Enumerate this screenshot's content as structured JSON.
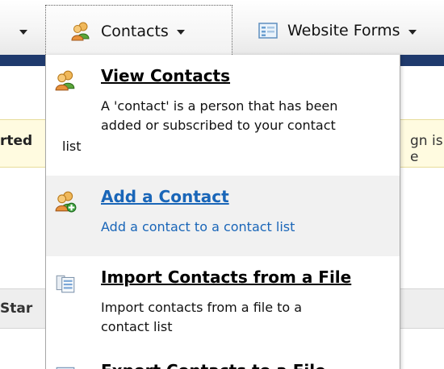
{
  "nav": {
    "contacts_label": "Contacts",
    "website_forms_label": "Website Forms"
  },
  "background": {
    "notice_left_text": "rted",
    "notice_right_text": "gn is e",
    "strip_left_text": "Star"
  },
  "menu": {
    "items": [
      {
        "title": "View Contacts",
        "desc_lines": [
          "A 'contact' is a person that has been",
          "added or subscribed to your contact",
          "list"
        ]
      },
      {
        "title": "Add a Contact",
        "desc_lines": [
          "Add a contact to a contact list"
        ]
      },
      {
        "title": "Import Contacts from a File",
        "desc_lines": [
          "Import contacts from a file to a",
          "contact list"
        ]
      },
      {
        "title": "Export Contacts to a File",
        "desc_lines": []
      }
    ]
  },
  "colors": {
    "nav_stripe": "#1f3a6d",
    "link_blue": "#1a66b8",
    "highlight_bg": "#f1f1f1"
  }
}
